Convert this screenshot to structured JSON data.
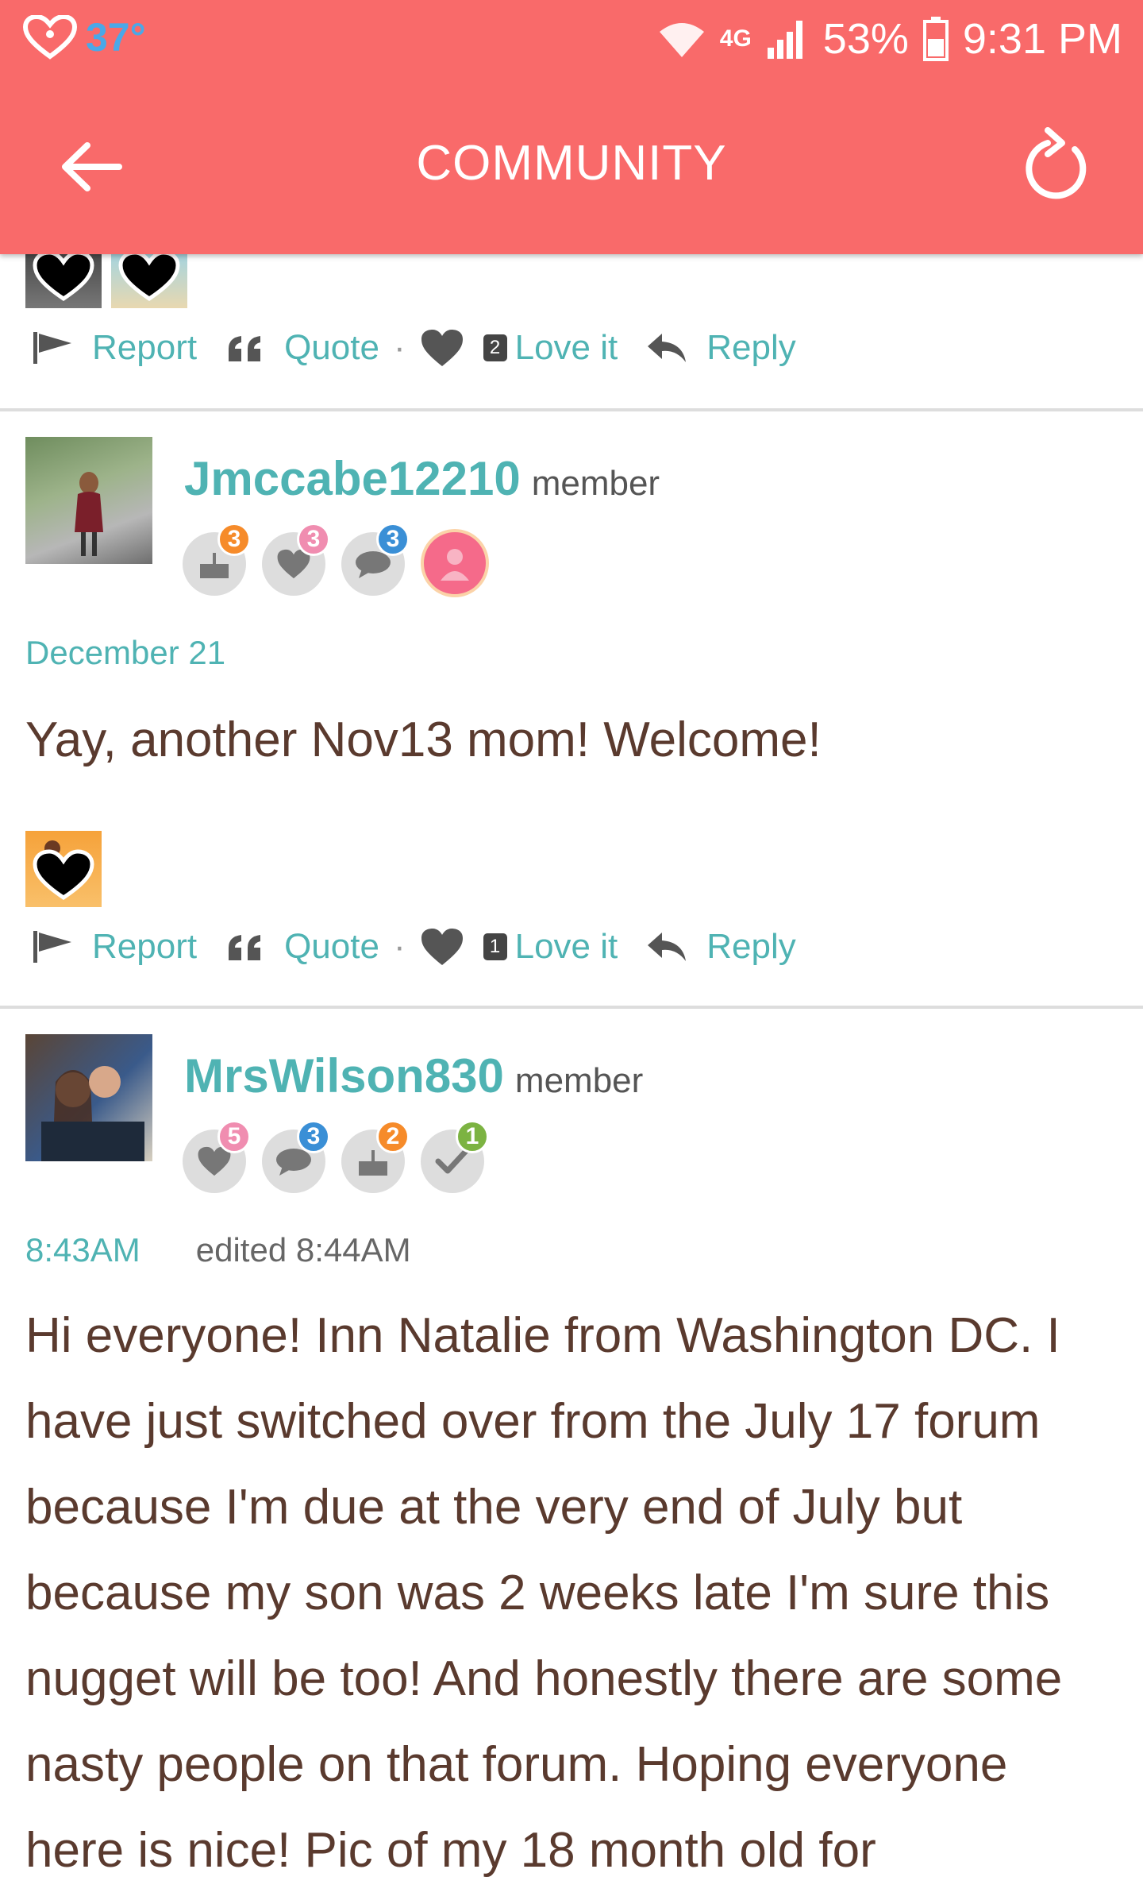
{
  "status": {
    "temperature": "37°",
    "network": "4G",
    "battery": "53%",
    "time": "9:31 PM"
  },
  "header": {
    "title": "COMMUNITY"
  },
  "colors": {
    "header": "#f96a6a",
    "accent": "#4fb3b3",
    "text": "#5a3a2e"
  },
  "actions_labels": {
    "report": "Report",
    "quote": "Quote",
    "love": "Love it",
    "reply": "Reply",
    "dot": "·"
  },
  "posts": [
    {
      "love_count": "2"
    },
    {
      "username": "Jmccabe12210",
      "role": "member",
      "badges": [
        {
          "icon": "cake-icon",
          "count": "3",
          "color": "#f68b2a"
        },
        {
          "icon": "heart-icon",
          "count": "3",
          "color": "#f08db0"
        },
        {
          "icon": "chat-icon",
          "count": "3",
          "color": "#3a8fd6"
        },
        {
          "icon": "person-icon",
          "count": "",
          "color": "#f56a8a"
        }
      ],
      "date": "December 21",
      "body": "Yay,  another Nov13 mom! Welcome!",
      "love_count": "1"
    },
    {
      "username": "MrsWilson830",
      "role": "member",
      "badges": [
        {
          "icon": "heart-icon",
          "count": "5",
          "color": "#f08db0"
        },
        {
          "icon": "chat-icon",
          "count": "3",
          "color": "#3a8fd6"
        },
        {
          "icon": "cake-icon",
          "count": "2",
          "color": "#f68b2a"
        },
        {
          "icon": "check-icon",
          "count": "1",
          "color": "#7cb342"
        }
      ],
      "date": "8:43AM",
      "edited": "edited 8:44AM",
      "body_lines": [
        "Hi everyone! Inn Natalie from Washington DC. I",
        "have just switched over from the July 17 forum",
        "because I'm due at the very end of July but",
        "because my son was 2 weeks late I'm sure this",
        "nugget will be too! And honestly there are some",
        "nasty people on that forum. Hoping everyone",
        "here is nice! Pic of my 18 month old for"
      ]
    }
  ]
}
